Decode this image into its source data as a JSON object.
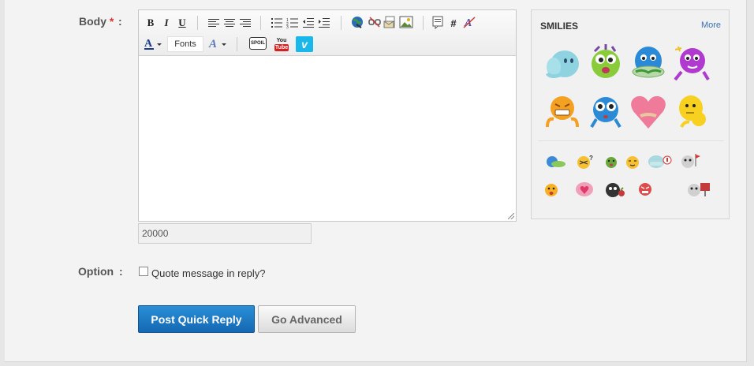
{
  "form": {
    "body_label": "Body",
    "required_mark": "*",
    "colon": ":",
    "option_label": "Option",
    "char_counter": "20000",
    "quote_label": "Quote message in reply?",
    "quote_checked": false
  },
  "toolbar": {
    "bold": "B",
    "italic": "I",
    "underline": "U",
    "fonts_label": "Fonts",
    "hash": "#",
    "spoiler": "SPOIL",
    "youtube_top": "You",
    "youtube_bottom": "Tube",
    "vimeo": "v"
  },
  "smilies": {
    "title": "SMILIES",
    "more_label": "More"
  },
  "buttons": {
    "post_quick_reply": "Post Quick Reply",
    "go_advanced": "Go Advanced"
  },
  "colors": {
    "primary": "#1a7ac6",
    "link": "#3a72b8",
    "required": "#dd3333"
  }
}
